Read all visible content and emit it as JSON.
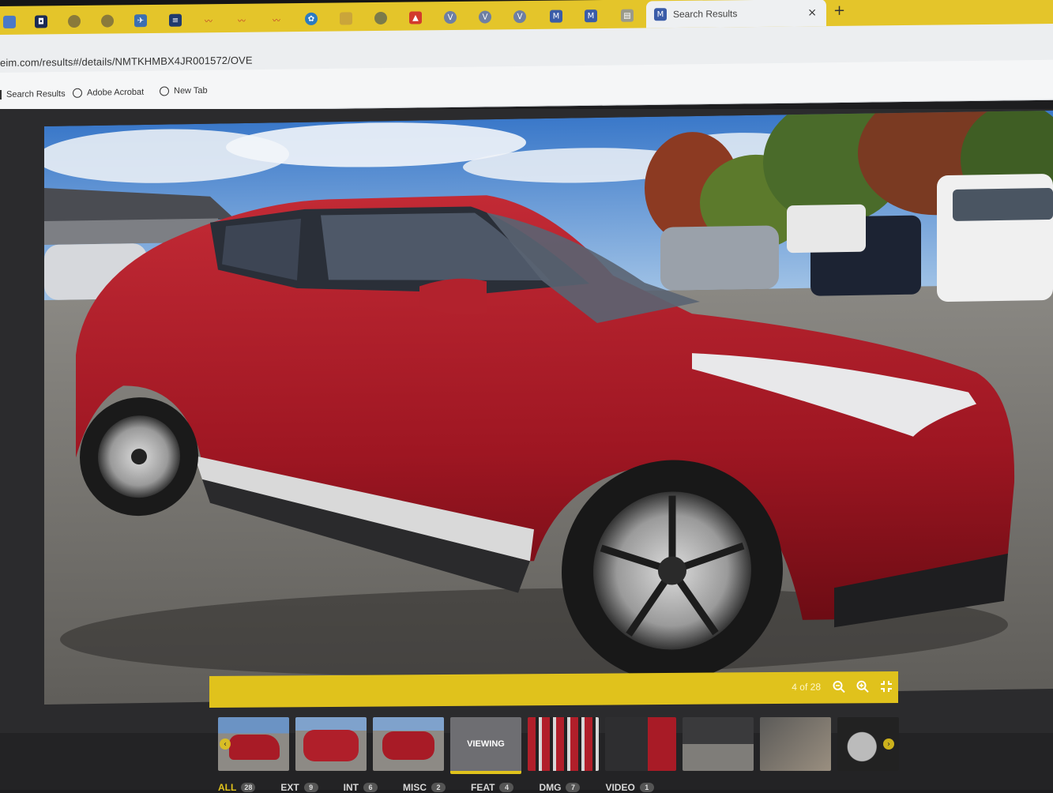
{
  "browser": {
    "tab_title": "Search Results",
    "close_glyph": "×",
    "new_tab_glyph": "+",
    "url": "eim.com/results#/details/NMTKHMBX4JR001572/OVE",
    "bookmarks": [
      "Search Results",
      "Adobe Acrobat",
      "New Tab"
    ]
  },
  "viewer": {
    "counter": "4 of 28",
    "icons": [
      "zoom-out-icon",
      "zoom-in-icon",
      "fullscreen-exit-icon"
    ],
    "viewing_label": "VIEWING",
    "accent_color": "#e0c21c"
  },
  "categories": [
    {
      "label": "ALL",
      "count": "28"
    },
    {
      "label": "EXT",
      "count": "9"
    },
    {
      "label": "INT",
      "count": "6"
    },
    {
      "label": "MISC",
      "count": "2"
    },
    {
      "label": "FEAT",
      "count": "4"
    },
    {
      "label": "DMG",
      "count": "7"
    },
    {
      "label": "VIDEO",
      "count": "1"
    }
  ]
}
